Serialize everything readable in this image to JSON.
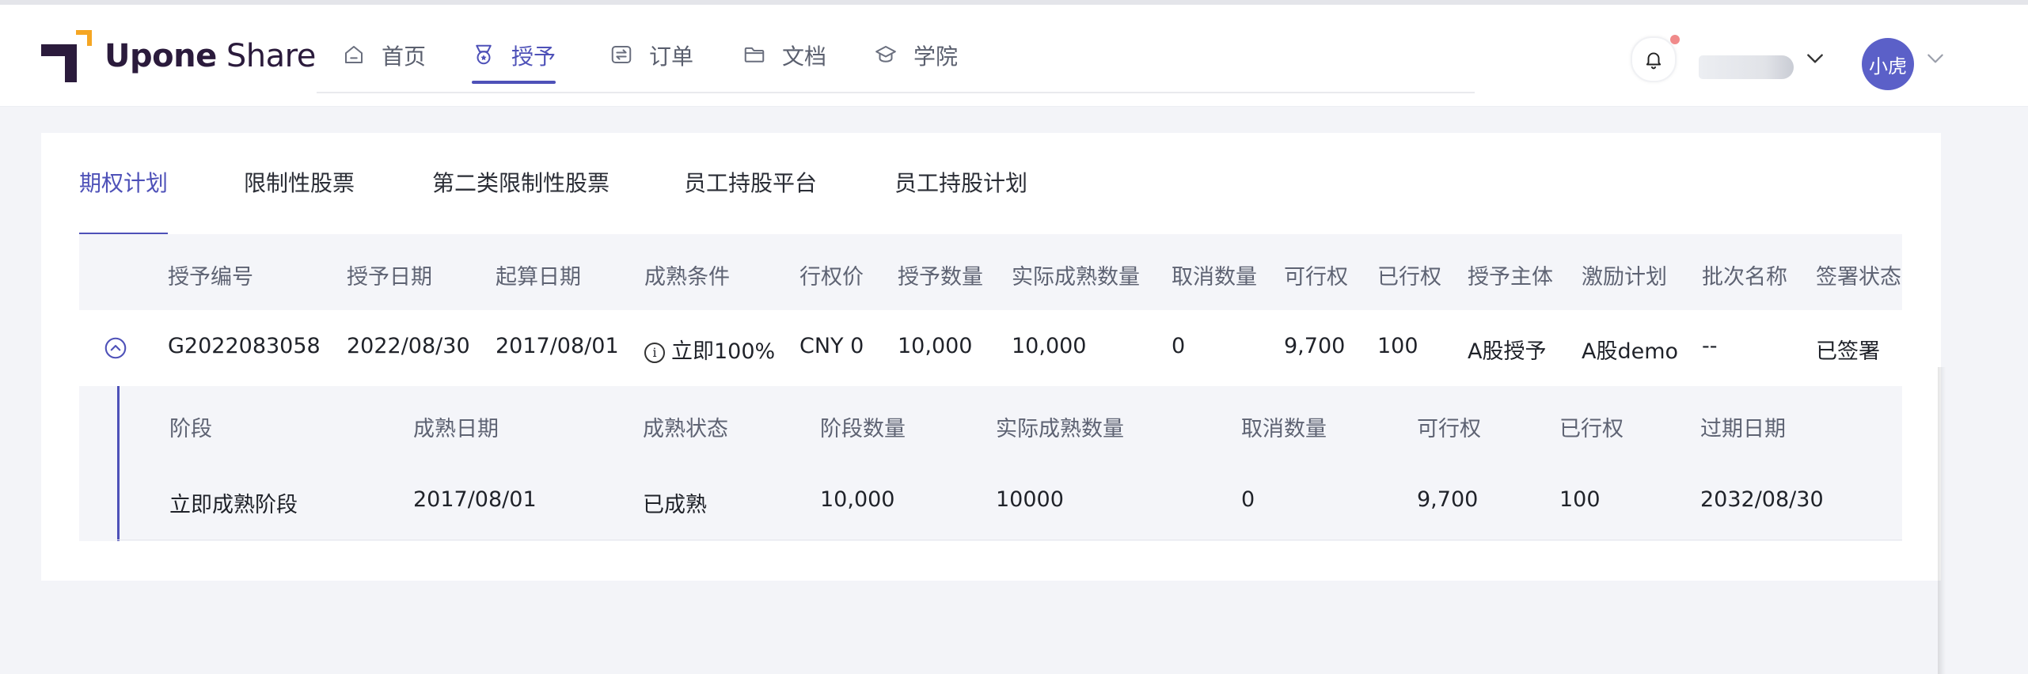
{
  "app": {
    "logo_text_bold": "Upone",
    "logo_text_light": " Share"
  },
  "nav": [
    {
      "label": "首页",
      "icon": "home-icon"
    },
    {
      "label": "授予",
      "icon": "award-medal-icon",
      "active": true
    },
    {
      "label": "订单",
      "icon": "exchange-icon"
    },
    {
      "label": "文档",
      "icon": "folder-icon"
    },
    {
      "label": "学院",
      "icon": "graduation-cap-icon"
    }
  ],
  "user": {
    "avatar_text": "小虎",
    "avatar_color": "#5b60c8",
    "notification_dot_color": "#f08a8a"
  },
  "tabs": [
    {
      "label": "期权计划",
      "active": true
    },
    {
      "label": "限制性股票"
    },
    {
      "label": "第二类限制性股票"
    },
    {
      "label": "员工持股平台"
    },
    {
      "label": "员工持股计划"
    }
  ],
  "table": {
    "columns": [
      "授予编号",
      "授予日期",
      "起算日期",
      "成熟条件",
      "行权价",
      "授予数量",
      "实际成熟数量",
      "取消数量",
      "可行权",
      "已行权",
      "授予主体",
      "激励计划",
      "批次名称",
      "签署状态"
    ],
    "rows": [
      {
        "grant_no": "G2022083058",
        "grant_date": "2022/08/30",
        "start_date": "2017/08/01",
        "vesting_condition": "立即100%",
        "exercise_price": "CNY  0",
        "grant_qty": "10,000",
        "actual_vested": "10,000",
        "cancelled": "0",
        "exercisable": "9,700",
        "exercised": "100",
        "grantor": "A股授予",
        "plan": "A股demo",
        "batch_name": "--",
        "sign_status": "已签署"
      }
    ],
    "sub_columns": [
      "阶段",
      "成熟日期",
      "成熟状态",
      "阶段数量",
      "实际成熟数量",
      "取消数量",
      "可行权",
      "已行权",
      "过期日期"
    ],
    "sub_rows": [
      {
        "stage": "立即成熟阶段",
        "vest_date": "2017/08/01",
        "status": "已成熟",
        "stage_qty": "10,000",
        "actual_vested": "10000",
        "cancelled": "0",
        "exercisable": "9,700",
        "exercised": "100",
        "expire_date": "2032/08/30"
      }
    ]
  },
  "colors": {
    "accent": "#4e51b8",
    "background": "#f3f4f8",
    "header_bg": "#f4f5f9"
  }
}
